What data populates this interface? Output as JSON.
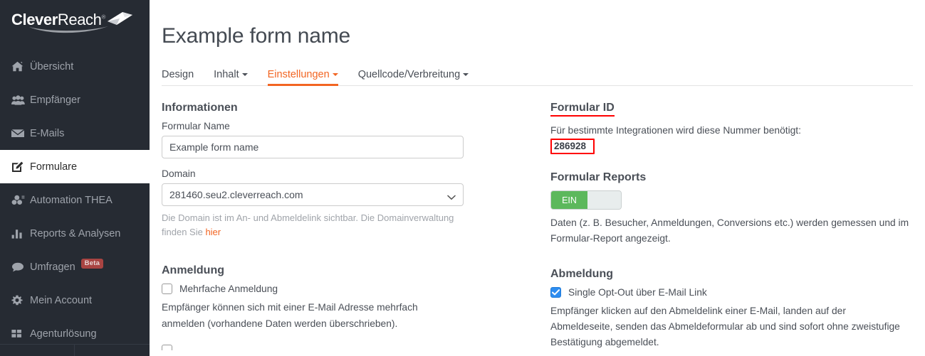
{
  "sidebar": {
    "brand": {
      "bold": "Clever",
      "light": "Reach",
      "mark": "®"
    },
    "items": [
      {
        "label": "Übersicht",
        "icon": "home-icon",
        "active": false,
        "badge": null
      },
      {
        "label": "Empfänger",
        "icon": "users-icon",
        "active": false,
        "badge": null
      },
      {
        "label": "E-Mails",
        "icon": "envelope-icon",
        "active": false,
        "badge": null
      },
      {
        "label": "Formulare",
        "icon": "form-edit-icon",
        "active": true,
        "badge": null
      },
      {
        "label": "Automation THEA",
        "icon": "automation-icon",
        "active": false,
        "badge": null
      },
      {
        "label": "Reports & Analysen",
        "icon": "bar-chart-icon",
        "active": false,
        "badge": null
      },
      {
        "label": "Umfragen",
        "icon": "chat-icon",
        "active": false,
        "badge": "Beta"
      },
      {
        "label": "Mein Account",
        "icon": "gear-icon",
        "active": false,
        "badge": null
      },
      {
        "label": "Agenturlösung",
        "icon": "grid-icon",
        "active": false,
        "badge": null
      }
    ]
  },
  "header": {
    "title": "Example form name"
  },
  "tabs": [
    {
      "label": "Design",
      "active": false,
      "dropdown": false
    },
    {
      "label": "Inhalt",
      "active": false,
      "dropdown": true
    },
    {
      "label": "Einstellungen",
      "active": true,
      "dropdown": true
    },
    {
      "label": "Quellcode/Verbreitung",
      "active": false,
      "dropdown": true
    }
  ],
  "left": {
    "informationen": {
      "heading": "Informationen",
      "name_label": "Formular Name",
      "name_value": "Example form name",
      "name_placeholder": "Formular Name",
      "domain_label": "Domain",
      "domain_value": "281460.seu2.cleverreach.com",
      "domain_options": [
        "281460.seu2.cleverreach.com"
      ],
      "domain_help_1": "Die Domain ist im An- und Abmeldelink sichtbar. Die Domainverwaltung",
      "domain_help_2": "finden Sie ",
      "domain_help_link": "hier"
    },
    "anmeldung": {
      "heading": "Anmeldung",
      "checkbox_label": "Mehrfache Anmeldung",
      "checked": false,
      "description_1": "Empfänger können sich mit einer E-Mail Adresse mehrfach",
      "description_2": "anmelden (vorhandene Daten werden überschrieben)."
    }
  },
  "right": {
    "formular_id": {
      "heading": "Formular ID",
      "note": "Für bestimmte Integrationen wird diese Nummer benötigt:",
      "value": "286928",
      "highlight_color": "#ff0000"
    },
    "formular_reports": {
      "heading": "Formular Reports",
      "toggle_label": "EIN",
      "toggle_on": true,
      "toggle_on_color": "#5cb85c",
      "description_1": "Daten (z. B. Besucher, Anmeldungen, Conversions etc.) werden gemessen und im",
      "description_2": "Formular-Report angezeigt."
    },
    "abmeldung": {
      "heading": "Abmeldung",
      "checkbox_label": "Single Opt-Out über E-Mail Link",
      "checked": true,
      "description_1": "Empfänger klicken auf den Abmeldelink einer E-Mail, landen auf der",
      "description_2": "Abmeldeseite, senden das Abmeldeformular ab und sind sofort ohne zweistufige",
      "description_3": "Bestätigung abgemeldet."
    }
  },
  "colors": {
    "accent": "#f26522",
    "sidebar_bg": "#262b33",
    "toggle_green": "#5cb85c",
    "badge_red": "#a94442",
    "highlight_red": "#ff0000",
    "checkbox_blue": "#2e8df0"
  }
}
